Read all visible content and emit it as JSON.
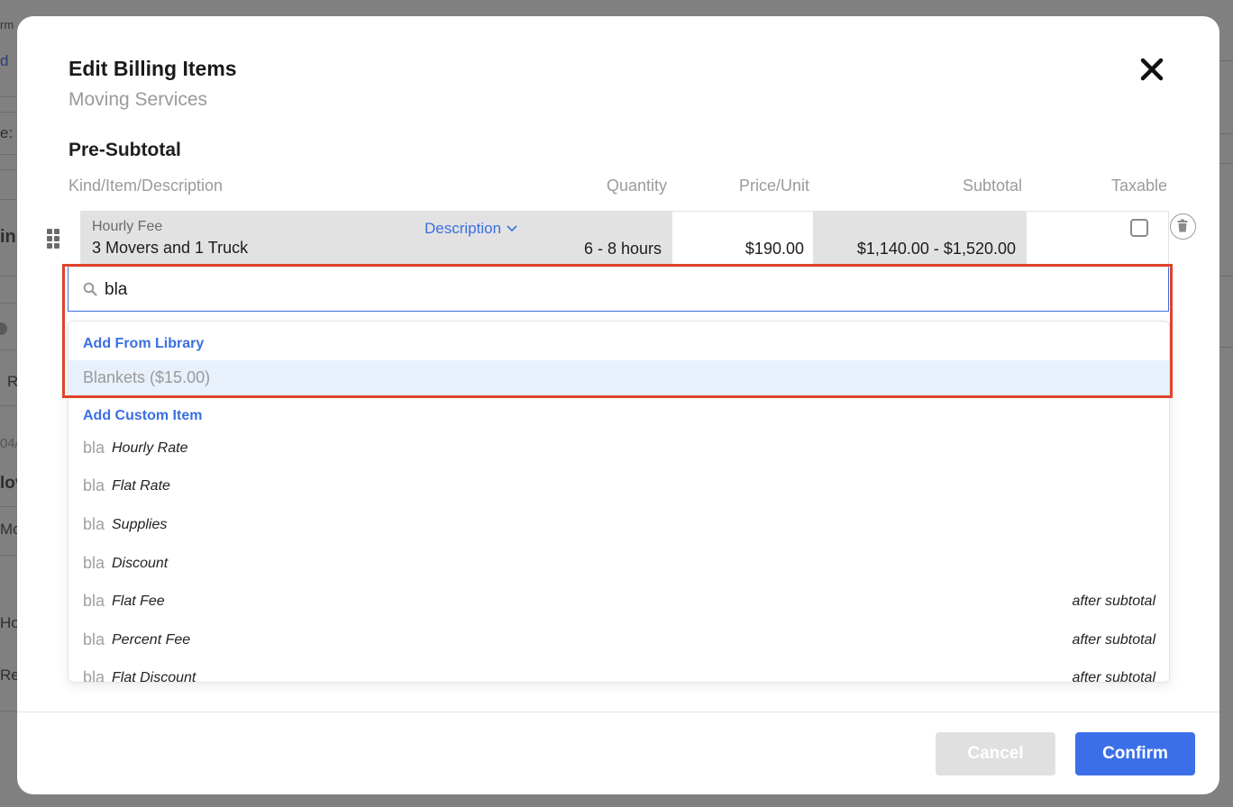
{
  "background": {
    "fragments": [
      "rm",
      "d",
      "e: (",
      "in",
      "R",
      "04/",
      "lov",
      "Mo",
      "Ho",
      "Re"
    ]
  },
  "modal": {
    "title": "Edit Billing Items",
    "subtitle": "Moving Services",
    "close_icon": "close-icon"
  },
  "section": {
    "title": "Pre-Subtotal",
    "columns": {
      "kind": "Kind/Item/Description",
      "quantity": "Quantity",
      "price": "Price/Unit",
      "subtotal": "Subtotal",
      "taxable": "Taxable"
    }
  },
  "billing_item": {
    "kind": "Hourly Fee",
    "name": "3 Movers and 1 Truck",
    "description_toggle": "Description",
    "quantity": "6 - 8 hours",
    "price": "$190.00",
    "subtotal": "$1,140.00 - $1,520.00",
    "taxable": false
  },
  "search": {
    "value": "bla",
    "placeholder": ""
  },
  "dropdown": {
    "library_label": "Add From Library",
    "library_items": [
      {
        "label": "Blankets ($15.00)"
      }
    ],
    "custom_label": "Add Custom Item",
    "custom_items": [
      {
        "query": "bla",
        "kind": "Hourly Rate",
        "note": ""
      },
      {
        "query": "bla",
        "kind": "Flat Rate",
        "note": ""
      },
      {
        "query": "bla",
        "kind": "Supplies",
        "note": ""
      },
      {
        "query": "bla",
        "kind": "Discount",
        "note": ""
      },
      {
        "query": "bla",
        "kind": "Flat Fee",
        "note": "after subtotal"
      },
      {
        "query": "bla",
        "kind": "Percent Fee",
        "note": "after subtotal"
      },
      {
        "query": "bla",
        "kind": "Flat Discount",
        "note": "after subtotal"
      }
    ]
  },
  "footer": {
    "cancel_label": "Cancel",
    "confirm_label": "Confirm"
  },
  "colors": {
    "accent": "#3b6fe8",
    "highlight": "#e0432b",
    "selected_row": "#e8f1fb"
  }
}
